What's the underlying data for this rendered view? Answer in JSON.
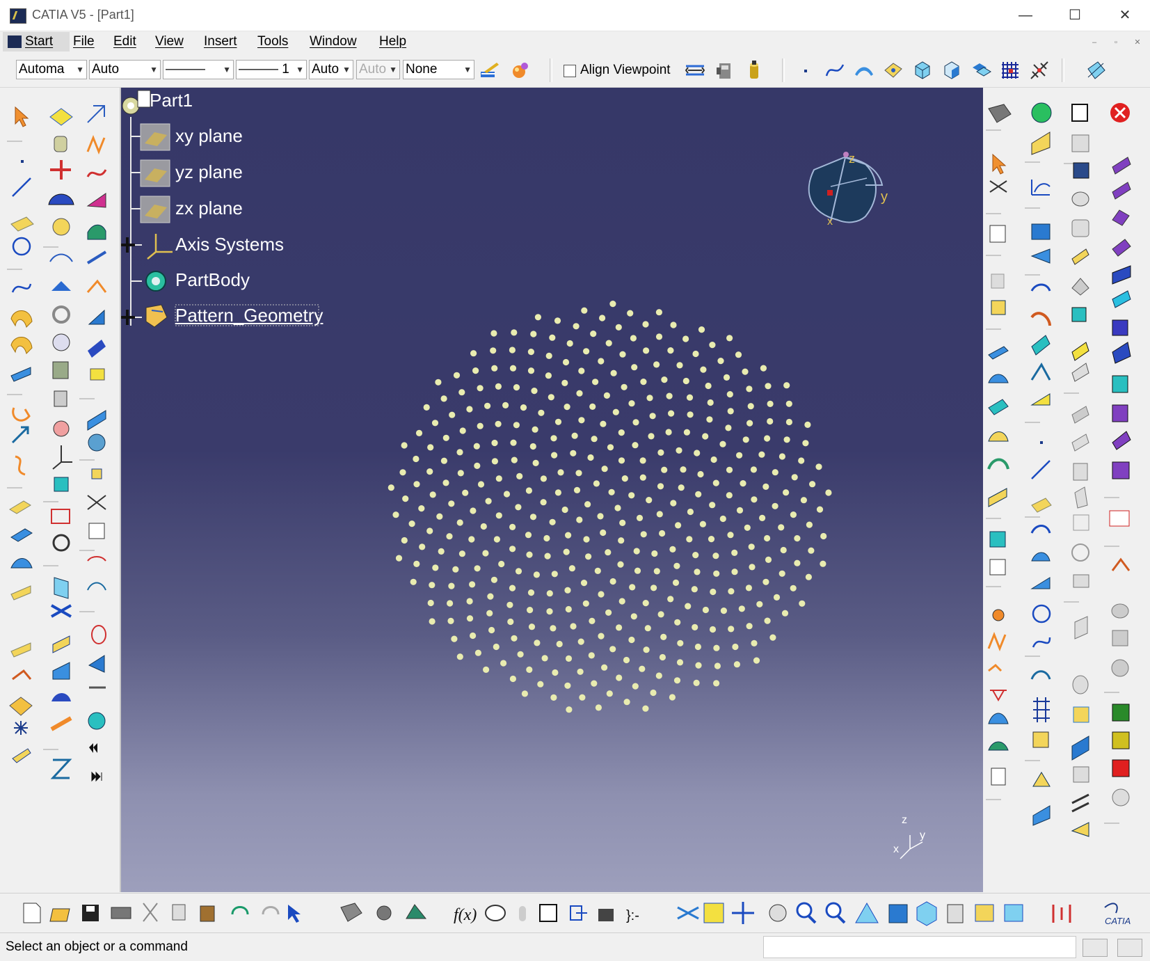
{
  "window": {
    "title": "CATIA V5 - [Part1]",
    "minimize": "—",
    "maximize": "☐",
    "close": "✕"
  },
  "menu": {
    "items": [
      "Start",
      "File",
      "Edit",
      "View",
      "Insert",
      "Tools",
      "Window",
      "Help"
    ]
  },
  "toolbar": {
    "fill_color": "Automa",
    "line_color": "Auto",
    "line_type": "———",
    "line_weight": "——— 1",
    "point_symbol": "Auto",
    "render_style": "Auto",
    "layer": "None",
    "align_viewpoint_label": "Align Viewpoint"
  },
  "tree": {
    "root": "Part1",
    "items": [
      "xy plane",
      "yz plane",
      "zx plane",
      "Axis Systems",
      "PartBody",
      "Pattern_Geometry"
    ]
  },
  "compass": {
    "x_label": "x",
    "y_label": "y",
    "z_label": "z"
  },
  "axis_triad": {
    "x_label": "x",
    "y_label": "y",
    "z_label": "z"
  },
  "pattern": {
    "point_count": 420,
    "point_color": "#e9ecb0"
  },
  "status": {
    "text": "Select an object or a command"
  },
  "colors": {
    "viewport_top": "#363868",
    "viewport_bottom": "#9d9fbc",
    "tree_text": "#ffffff"
  }
}
